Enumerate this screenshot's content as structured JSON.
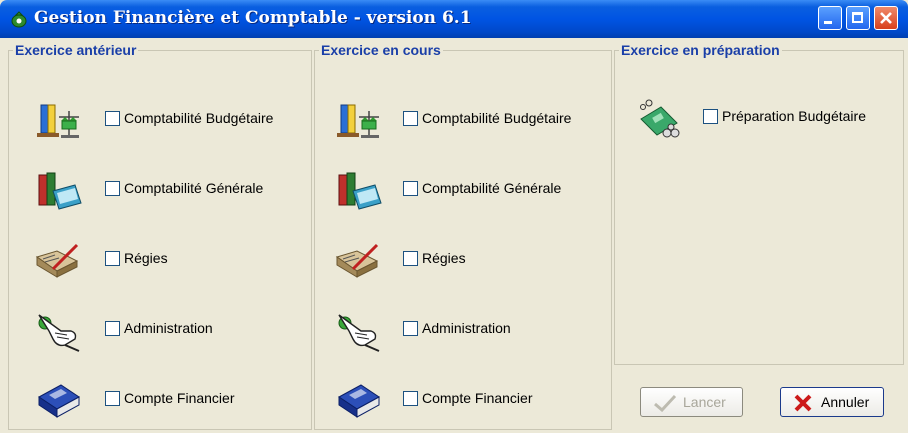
{
  "window": {
    "title": "Gestion Financière et Comptable - version 6.1"
  },
  "groups": [
    {
      "title": "Exercice antérieur",
      "items": [
        {
          "label": "Comptabilité Budgétaire",
          "icon": "budget-scale-icon",
          "checked": false
        },
        {
          "label": "Comptabilité Générale",
          "icon": "books-icon",
          "checked": false
        },
        {
          "label": "Régies",
          "icon": "ledger-pen-icon",
          "checked": false
        },
        {
          "label": "Administration",
          "icon": "pointing-hand-icon",
          "checked": false
        },
        {
          "label": "Compte Financier",
          "icon": "blue-book-icon",
          "checked": false
        }
      ]
    },
    {
      "title": "Exercice en cours",
      "items": [
        {
          "label": "Comptabilité Budgétaire",
          "icon": "budget-scale-icon",
          "checked": false
        },
        {
          "label": "Comptabilité Générale",
          "icon": "books-icon",
          "checked": false
        },
        {
          "label": "Régies",
          "icon": "ledger-pen-icon",
          "checked": false
        },
        {
          "label": "Administration",
          "icon": "pointing-hand-icon",
          "checked": false
        },
        {
          "label": "Compte Financier",
          "icon": "blue-book-icon",
          "checked": false
        }
      ]
    },
    {
      "title": "Exercice en préparation",
      "items": [
        {
          "label": "Préparation Budgétaire",
          "icon": "money-coins-icon",
          "checked": false
        }
      ]
    }
  ],
  "buttons": {
    "lancer": {
      "label": "Lancer",
      "enabled": false
    },
    "annuler": {
      "label": "Annuler",
      "enabled": true
    }
  },
  "colors": {
    "group_title": "#1a3fa8",
    "titlebar": "#0054e3",
    "background": "#ece9d8"
  }
}
